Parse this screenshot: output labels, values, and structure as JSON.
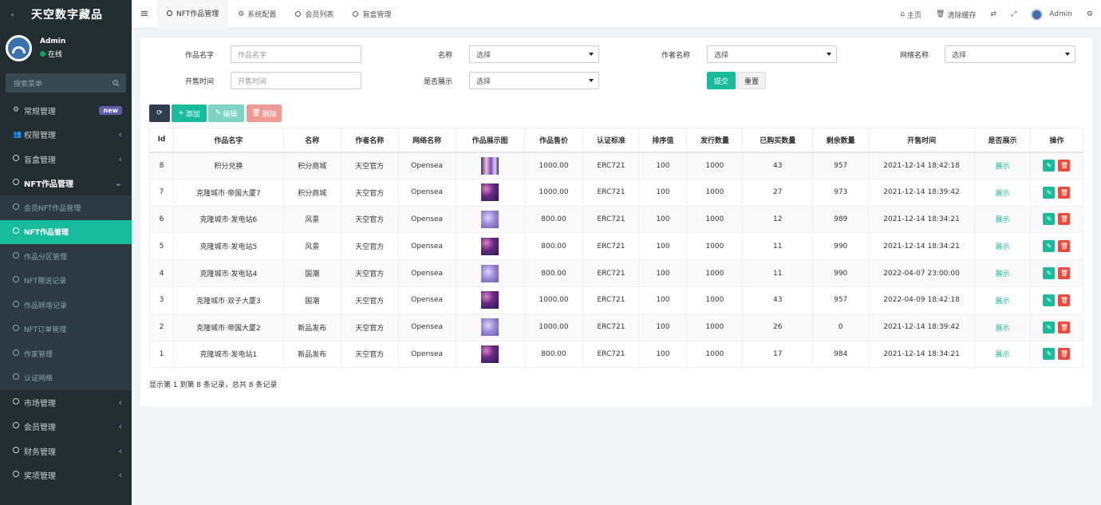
{
  "sidebar": {
    "brand": "天空数字藏品",
    "user": {
      "name": "Admin",
      "status": "在线"
    },
    "search_placeholder": "搜索菜单",
    "items": [
      {
        "label": "常规管理",
        "badge": "new",
        "icon": "gears-icon"
      },
      {
        "label": "权限管理",
        "icon": "users-icon"
      },
      {
        "label": "盲盒管理",
        "icon": "circle-icon"
      },
      {
        "label": "NFT作品管理",
        "icon": "circle-icon"
      }
    ],
    "sub_items": [
      {
        "label": "会员NFT作品管理"
      },
      {
        "label": "NFT作品管理",
        "active": true
      },
      {
        "label": "作品分区管理"
      },
      {
        "label": "NFT赠送记录"
      },
      {
        "label": "作品转增记录"
      },
      {
        "label": "NFT订单管理"
      },
      {
        "label": "作家管理"
      },
      {
        "label": "认证网络"
      }
    ],
    "bottom_items": [
      {
        "label": "市场管理"
      },
      {
        "label": "会员管理"
      },
      {
        "label": "财务管理"
      },
      {
        "label": "奖项管理"
      }
    ]
  },
  "topbar": {
    "tabs": [
      {
        "label": "NFT作品管理",
        "icon": "circle-icon"
      },
      {
        "label": "系统配置",
        "icon": "gear-icon"
      },
      {
        "label": "会员列表",
        "icon": "circle-icon"
      },
      {
        "label": "盲盒管理",
        "icon": "circle-icon"
      }
    ],
    "home_label": "主页",
    "clear_cache_label": "清除缓存",
    "user_label": "Admin"
  },
  "filters": {
    "work_name_label": "作品名字",
    "work_name_placeholder": "作品名字",
    "name_label": "名称",
    "name_value": "选择",
    "author_label": "作者名称",
    "author_value": "选择",
    "network_label": "网络名称",
    "network_value": "选择",
    "sale_time_label": "开售时间",
    "sale_time_placeholder": "开售时间",
    "show_label": "是否展示",
    "show_value": "选择",
    "submit_label": "提交",
    "reset_label": "重置"
  },
  "toolbar": {
    "add_label": "添加",
    "edit_label": "编辑",
    "delete_label": "删除"
  },
  "table": {
    "headers": [
      "Id",
      "作品名字",
      "名称",
      "作者名称",
      "网络名称",
      "作品展示图",
      "作品售价",
      "认证标准",
      "排序值",
      "发行数量",
      "已购买数量",
      "剩余数量",
      "开售时间",
      "是否展示",
      "操作"
    ],
    "rows": [
      {
        "id": "8",
        "work": "积分兑换",
        "name": "积分商城",
        "author": "天空官方",
        "network": "Opensea",
        "price": "1000.00",
        "standard": "ERC721",
        "sort": "100",
        "issued": "1000",
        "bought": "43",
        "remaining": "957",
        "time": "2021-12-14 18:42:18",
        "show": "展示",
        "thumb": "t1"
      },
      {
        "id": "7",
        "work": "克隆城市·帝国大厦7",
        "name": "积分商城",
        "author": "天空官方",
        "network": "Opensea",
        "price": "1000.00",
        "standard": "ERC721",
        "sort": "100",
        "issued": "1000",
        "bought": "27",
        "remaining": "973",
        "time": "2021-12-14 18:39:42",
        "show": "展示",
        "thumb": "t2"
      },
      {
        "id": "6",
        "work": "克隆城市·发电站6",
        "name": "风景",
        "author": "天空官方",
        "network": "Opensea",
        "price": "800.00",
        "standard": "ERC721",
        "sort": "100",
        "issued": "1000",
        "bought": "12",
        "remaining": "989",
        "time": "2021-12-14 18:34:21",
        "show": "展示",
        "thumb": "t3"
      },
      {
        "id": "5",
        "work": "克隆城市·发电站5",
        "name": "风景",
        "author": "天空官方",
        "network": "Opensea",
        "price": "800.00",
        "standard": "ERC721",
        "sort": "100",
        "issued": "1000",
        "bought": "11",
        "remaining": "990",
        "time": "2021-12-14 18:34:21",
        "show": "展示",
        "thumb": "t2"
      },
      {
        "id": "4",
        "work": "克隆城市·发电站4",
        "name": "国潮",
        "author": "天空官方",
        "network": "Opensea",
        "price": "800.00",
        "standard": "ERC721",
        "sort": "100",
        "issued": "1000",
        "bought": "11",
        "remaining": "990",
        "time": "2022-04-07 23:00:00",
        "show": "展示",
        "thumb": "t3"
      },
      {
        "id": "3",
        "work": "克隆城市·双子大厦3",
        "name": "国潮",
        "author": "天空官方",
        "network": "Opensea",
        "price": "1000.00",
        "standard": "ERC721",
        "sort": "100",
        "issued": "1000",
        "bought": "43",
        "remaining": "957",
        "time": "2022-04-09 18:42:18",
        "show": "展示",
        "thumb": "t2"
      },
      {
        "id": "2",
        "work": "克隆城市·帝国大厦2",
        "name": "新品发布",
        "author": "天空官方",
        "network": "Opensea",
        "price": "1000.00",
        "standard": "ERC721",
        "sort": "100",
        "issued": "1000",
        "bought": "26",
        "remaining": "0",
        "time": "2021-12-14 18:39:42",
        "show": "展示",
        "thumb": "t3"
      },
      {
        "id": "1",
        "work": "克隆城市·发电站1",
        "name": "新品发布",
        "author": "天空官方",
        "network": "Opensea",
        "price": "800.00",
        "standard": "ERC721",
        "sort": "100",
        "issued": "1000",
        "bought": "17",
        "remaining": "984",
        "time": "2021-12-14 18:34:21",
        "show": "展示",
        "thumb": "t2"
      }
    ]
  },
  "pager": {
    "summary": "显示第 1 到第 8 条记录，总共 8 条记录"
  }
}
